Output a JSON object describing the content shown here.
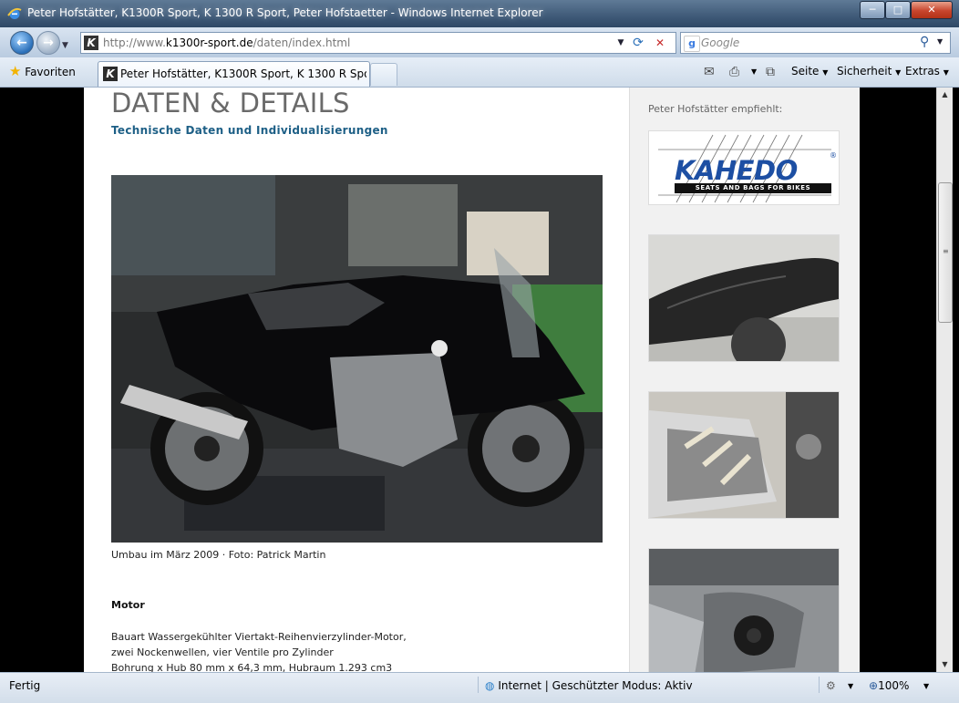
{
  "window": {
    "title": "Peter Hofstätter, K1300R Sport, K 1300 R Sport, Peter Hofstaetter - Windows Internet Explorer",
    "minimize": "─",
    "maximize": "□",
    "close": "✕"
  },
  "nav": {
    "url_prefix": "http://www.",
    "url_domain": "k1300r-sport.de",
    "url_path": "/daten/index.html",
    "search_placeholder": "Google",
    "back_icon": "back-arrow-icon",
    "forward_icon": "forward-arrow-icon"
  },
  "toolbar": {
    "favorites_label": "Favoriten",
    "tab_title": "Peter Hofstätter, K1300R Sport, K 1300 R Sport, Pe...",
    "seite_label": "Seite",
    "sicherheit_label": "Sicherheit",
    "extras_label": "Extras"
  },
  "page": {
    "heading": "DATEN & DETAILS",
    "subtitle": "Technische Daten und Individualisierungen",
    "photo_caption": "Umbau im März 2009 · Foto: Patrick Martin",
    "section_title": "Motor",
    "motor_lines": [
      "Bauart Wassergekühlter Viertakt-Reihenvierzylinder-Motor,",
      "zwei Nockenwellen, vier Ventile pro Zylinder",
      "Bohrung x Hub 80 mm x 64,3 mm, Hubraum 1.293 cm3"
    ]
  },
  "sidebar": {
    "recommend_label": "Peter Hofstätter empfiehlt:",
    "logo_word": "KAHEDO",
    "logo_tagline": "SEATS AND BAGS FOR BIKES",
    "logo_registered": "®"
  },
  "status": {
    "state": "Fertig",
    "zone": "Internet | Geschützter Modus: Aktiv",
    "zoom": "100%"
  },
  "colors": {
    "heading": "#6a6a6a",
    "subtitle": "#1d5f86",
    "kahedo_blue": "#1d4fa3"
  }
}
